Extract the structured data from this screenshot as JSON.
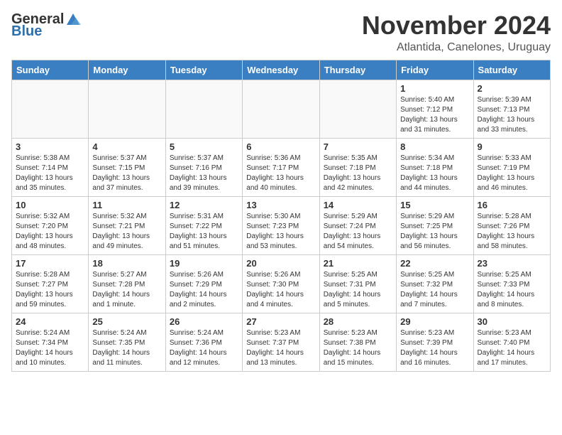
{
  "logo": {
    "general": "General",
    "blue": "Blue"
  },
  "title": "November 2024",
  "subtitle": "Atlantida, Canelones, Uruguay",
  "days_of_week": [
    "Sunday",
    "Monday",
    "Tuesday",
    "Wednesday",
    "Thursday",
    "Friday",
    "Saturday"
  ],
  "weeks": [
    [
      {
        "day": "",
        "info": ""
      },
      {
        "day": "",
        "info": ""
      },
      {
        "day": "",
        "info": ""
      },
      {
        "day": "",
        "info": ""
      },
      {
        "day": "",
        "info": ""
      },
      {
        "day": "1",
        "info": "Sunrise: 5:40 AM\nSunset: 7:12 PM\nDaylight: 13 hours and 31 minutes."
      },
      {
        "day": "2",
        "info": "Sunrise: 5:39 AM\nSunset: 7:13 PM\nDaylight: 13 hours and 33 minutes."
      }
    ],
    [
      {
        "day": "3",
        "info": "Sunrise: 5:38 AM\nSunset: 7:14 PM\nDaylight: 13 hours and 35 minutes."
      },
      {
        "day": "4",
        "info": "Sunrise: 5:37 AM\nSunset: 7:15 PM\nDaylight: 13 hours and 37 minutes."
      },
      {
        "day": "5",
        "info": "Sunrise: 5:37 AM\nSunset: 7:16 PM\nDaylight: 13 hours and 39 minutes."
      },
      {
        "day": "6",
        "info": "Sunrise: 5:36 AM\nSunset: 7:17 PM\nDaylight: 13 hours and 40 minutes."
      },
      {
        "day": "7",
        "info": "Sunrise: 5:35 AM\nSunset: 7:18 PM\nDaylight: 13 hours and 42 minutes."
      },
      {
        "day": "8",
        "info": "Sunrise: 5:34 AM\nSunset: 7:18 PM\nDaylight: 13 hours and 44 minutes."
      },
      {
        "day": "9",
        "info": "Sunrise: 5:33 AM\nSunset: 7:19 PM\nDaylight: 13 hours and 46 minutes."
      }
    ],
    [
      {
        "day": "10",
        "info": "Sunrise: 5:32 AM\nSunset: 7:20 PM\nDaylight: 13 hours and 48 minutes."
      },
      {
        "day": "11",
        "info": "Sunrise: 5:32 AM\nSunset: 7:21 PM\nDaylight: 13 hours and 49 minutes."
      },
      {
        "day": "12",
        "info": "Sunrise: 5:31 AM\nSunset: 7:22 PM\nDaylight: 13 hours and 51 minutes."
      },
      {
        "day": "13",
        "info": "Sunrise: 5:30 AM\nSunset: 7:23 PM\nDaylight: 13 hours and 53 minutes."
      },
      {
        "day": "14",
        "info": "Sunrise: 5:29 AM\nSunset: 7:24 PM\nDaylight: 13 hours and 54 minutes."
      },
      {
        "day": "15",
        "info": "Sunrise: 5:29 AM\nSunset: 7:25 PM\nDaylight: 13 hours and 56 minutes."
      },
      {
        "day": "16",
        "info": "Sunrise: 5:28 AM\nSunset: 7:26 PM\nDaylight: 13 hours and 58 minutes."
      }
    ],
    [
      {
        "day": "17",
        "info": "Sunrise: 5:28 AM\nSunset: 7:27 PM\nDaylight: 13 hours and 59 minutes."
      },
      {
        "day": "18",
        "info": "Sunrise: 5:27 AM\nSunset: 7:28 PM\nDaylight: 14 hours and 1 minute."
      },
      {
        "day": "19",
        "info": "Sunrise: 5:26 AM\nSunset: 7:29 PM\nDaylight: 14 hours and 2 minutes."
      },
      {
        "day": "20",
        "info": "Sunrise: 5:26 AM\nSunset: 7:30 PM\nDaylight: 14 hours and 4 minutes."
      },
      {
        "day": "21",
        "info": "Sunrise: 5:25 AM\nSunset: 7:31 PM\nDaylight: 14 hours and 5 minutes."
      },
      {
        "day": "22",
        "info": "Sunrise: 5:25 AM\nSunset: 7:32 PM\nDaylight: 14 hours and 7 minutes."
      },
      {
        "day": "23",
        "info": "Sunrise: 5:25 AM\nSunset: 7:33 PM\nDaylight: 14 hours and 8 minutes."
      }
    ],
    [
      {
        "day": "24",
        "info": "Sunrise: 5:24 AM\nSunset: 7:34 PM\nDaylight: 14 hours and 10 minutes."
      },
      {
        "day": "25",
        "info": "Sunrise: 5:24 AM\nSunset: 7:35 PM\nDaylight: 14 hours and 11 minutes."
      },
      {
        "day": "26",
        "info": "Sunrise: 5:24 AM\nSunset: 7:36 PM\nDaylight: 14 hours and 12 minutes."
      },
      {
        "day": "27",
        "info": "Sunrise: 5:23 AM\nSunset: 7:37 PM\nDaylight: 14 hours and 13 minutes."
      },
      {
        "day": "28",
        "info": "Sunrise: 5:23 AM\nSunset: 7:38 PM\nDaylight: 14 hours and 15 minutes."
      },
      {
        "day": "29",
        "info": "Sunrise: 5:23 AM\nSunset: 7:39 PM\nDaylight: 14 hours and 16 minutes."
      },
      {
        "day": "30",
        "info": "Sunrise: 5:23 AM\nSunset: 7:40 PM\nDaylight: 14 hours and 17 minutes."
      }
    ]
  ]
}
